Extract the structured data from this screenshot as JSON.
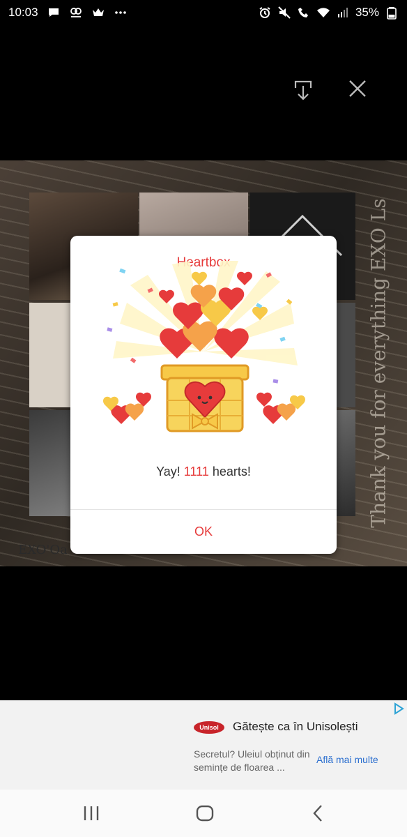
{
  "status_bar": {
    "time": "10:03",
    "battery": "35%",
    "left_icons": [
      "message-icon",
      "mood-icon",
      "crown-icon",
      "more-icon"
    ],
    "right_icons": [
      "alarm-icon",
      "mute-icon",
      "wifi-calling-icon",
      "wifi-icon",
      "signal-icon",
      "battery-icon"
    ]
  },
  "viewer": {
    "download_icon": "download-icon",
    "close_icon": "close-icon",
    "side_caption": "Thank you for everything EXO Ls",
    "bottom_caption": "EXO'Oa"
  },
  "dialog": {
    "title": "Heartbox",
    "message_prefix": "Yay! ",
    "count": "1111",
    "message_suffix": " hearts!",
    "ok_label": "OK",
    "accent_color": "#e63b3b"
  },
  "ad": {
    "logo_text": "Unisol",
    "title": "Gătește ca în Unisolești",
    "description": "Secretul? Uleiul obținut din semințe de floarea ...",
    "cta": "Află mai multe",
    "cta_color": "#2c6fcf"
  },
  "nav_bar": {
    "recent_icon": "recent-apps-icon",
    "home_icon": "home-icon",
    "back_icon": "back-icon"
  }
}
